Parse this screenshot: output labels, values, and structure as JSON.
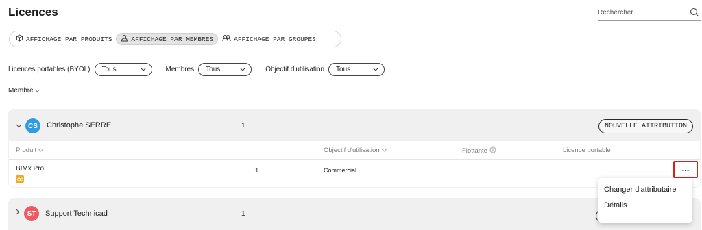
{
  "page": {
    "title": "Licences"
  },
  "search": {
    "placeholder": "Rechercher",
    "icon": "search-icon"
  },
  "view_tabs": [
    {
      "label": "AFFICHAGE PAR PRODUITS",
      "icon": "cube-icon",
      "active": false
    },
    {
      "label": "AFFICHAGE PAR MEMBRES",
      "icon": "person-icon",
      "active": true
    },
    {
      "label": "AFFICHAGE PAR GROUPES",
      "icon": "people-icon",
      "active": false
    }
  ],
  "filters": {
    "byol": {
      "label": "Licences portables (BYOL)",
      "value": "Tous"
    },
    "members": {
      "label": "Membres",
      "value": "Tous"
    },
    "purpose": {
      "label": "Objectif d'utilisation",
      "value": "Tous"
    }
  },
  "sort": {
    "label": "Membre"
  },
  "groups": [
    {
      "initials": "CS",
      "avatar_color": "#2f9be0",
      "name": "Christophe SERRE",
      "count": "1",
      "expanded": true,
      "assign_label": "NOUVELLE ATTRIBUTION",
      "columns": {
        "product": "Produit",
        "purpose": "Objectif d'utilisation",
        "floating": "Flottante",
        "portable": "Licence portable"
      },
      "rows": [
        {
          "product": "BIMx Pro",
          "product_icon": "link-icon",
          "product_icon_color": "#f5a623",
          "count": "1",
          "purpose": "Commercial"
        }
      ]
    },
    {
      "initials": "ST",
      "avatar_color": "#ee5a5f",
      "name": "Support Technicad",
      "count": "1",
      "expanded": false,
      "assign_label": "N"
    }
  ],
  "row_menu": {
    "trigger": "...",
    "items": [
      "Changer d'attributaire",
      "Détails"
    ]
  },
  "colors": {
    "highlight_border": "#d9201c",
    "group_bg": "#f0f0f0"
  }
}
